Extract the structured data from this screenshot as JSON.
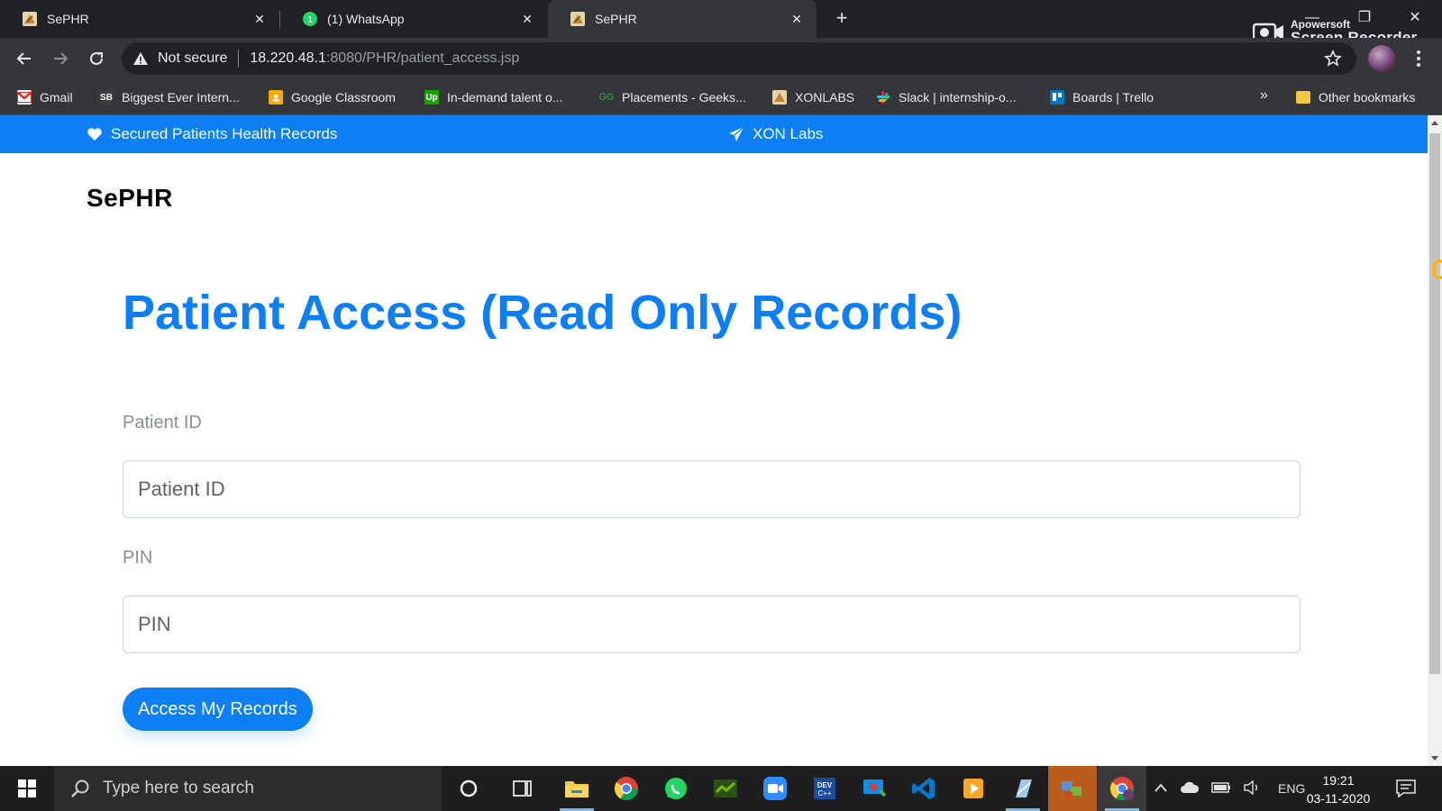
{
  "browser": {
    "tabs": [
      {
        "title": "SePHR",
        "icon": "sephr-favicon",
        "active": false
      },
      {
        "title": "(1) WhatsApp",
        "icon": "whatsapp-favicon",
        "active": false
      },
      {
        "title": "SePHR",
        "icon": "sephr-favicon",
        "active": true
      }
    ],
    "new_tab_icon": "plus-icon",
    "address": {
      "security_label": "Not secure",
      "host": "18.220.48.1",
      "path": ":8080/PHR/patient_access.jsp"
    },
    "bookmarks": [
      {
        "label": "Gmail",
        "icon": "gmail-icon",
        "color": "#d93025"
      },
      {
        "label": "Biggest Ever Intern...",
        "icon": "sb-icon",
        "color": "#3c3c3c"
      },
      {
        "label": "Google Classroom",
        "icon": "classroom-icon",
        "color": "#f9ab00"
      },
      {
        "label": "In-demand talent o...",
        "icon": "upwork-icon",
        "color": "#14a800"
      },
      {
        "label": "Placements - Geeks...",
        "icon": "gfg-icon",
        "color": "#2f8d46"
      },
      {
        "label": "XONLABS",
        "icon": "xonlabs-icon",
        "color": "#c8a45e"
      },
      {
        "label": "Slack | internship-o...",
        "icon": "slack-icon",
        "color": "#611f69"
      },
      {
        "label": "Boards | Trello",
        "icon": "trello-icon",
        "color": "#0079bf"
      }
    ],
    "more_bookmarks": "»",
    "other_bookmarks": "Other bookmarks"
  },
  "recorder": {
    "line1": "Apowersoft",
    "line2": "Screen Recorder"
  },
  "page": {
    "topbar": {
      "left_text": "Secured Patients Health Records",
      "left_icon": "heart-icon",
      "center_text": "XON Labs",
      "center_icon": "paper-plane-icon"
    },
    "brand": "SePHR",
    "heading": "Patient Access (Read Only Records)",
    "form": {
      "patient_id_label": "Patient ID",
      "patient_id_placeholder": "Patient ID",
      "pin_label": "PIN",
      "pin_placeholder": "PIN",
      "submit_label": "Access My Records"
    },
    "colors": {
      "primary": "#0d7ff5",
      "text_muted": "#8a8f95"
    }
  },
  "taskbar": {
    "search_placeholder": "Type here to search",
    "apps": [
      "cortana-icon",
      "task-view-icon",
      "file-explorer-icon",
      "chrome-icon",
      "whatsapp-icon",
      "nvidia-icon",
      "zoom-icon",
      "devc-icon",
      "teamviewer-icon",
      "vscode-icon",
      "media-player-icon",
      "notepad-icon",
      "network-icon",
      "chrome-profile-icon"
    ],
    "tray": {
      "language": "ENG",
      "time": "19:21",
      "date": "03-11-2020"
    }
  }
}
